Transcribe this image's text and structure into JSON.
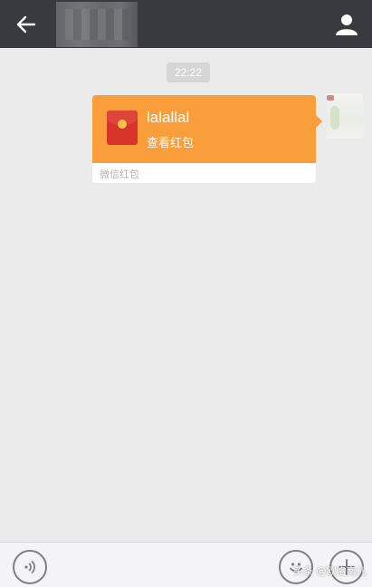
{
  "header": {
    "back_icon": "arrow-left-icon",
    "profile_icon": "person-icon",
    "background": "#393a3f"
  },
  "chat": {
    "timestamp": "22:22",
    "message": {
      "type": "red-packet",
      "title": "lalallal",
      "subtitle": "查看红包",
      "footer": "微信红包",
      "color": "#fa9d3b"
    }
  },
  "input_bar": {
    "voice_icon": "voice-icon",
    "emoji_icon": "emoji-icon",
    "plus_icon": "plus-icon"
  },
  "watermark": {
    "text": "头条 @欧洛南儿"
  }
}
